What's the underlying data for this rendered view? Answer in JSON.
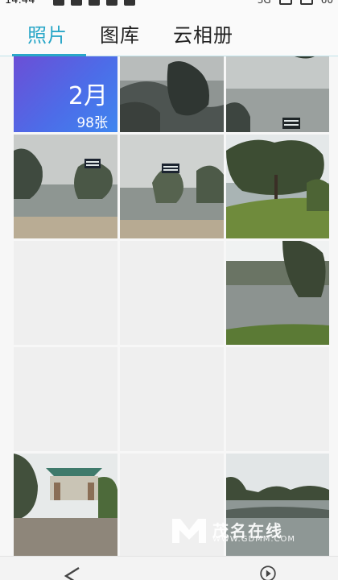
{
  "status_bar": {
    "time": "14:44",
    "signal_label": "3G",
    "right_text": "60"
  },
  "tabs": [
    {
      "label": "照片",
      "active": true
    },
    {
      "label": "图库",
      "active": false
    },
    {
      "label": "云相册",
      "active": false
    }
  ],
  "month_tile": {
    "month": "2月",
    "count": "98张"
  },
  "watermark": {
    "brand": "茂名在线",
    "url": "WWW.GDMM.COM"
  },
  "colors": {
    "accent": "#2aa7c8",
    "tile_gradient_start": "#6b4fd6",
    "tile_gradient_end": "#3f86ef"
  },
  "icons": {
    "back": "back-triangle-icon",
    "play": "play-circle-icon"
  }
}
